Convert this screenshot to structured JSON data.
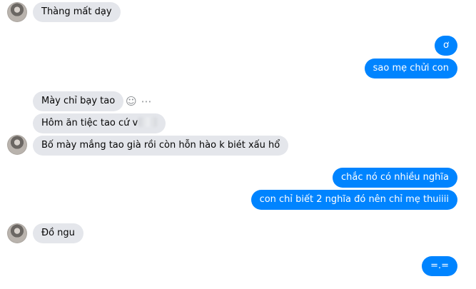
{
  "messages": [
    {
      "id": "m1",
      "side": "in",
      "text": "Thàng mất dạy"
    },
    {
      "id": "m2",
      "side": "out",
      "text": "ơ"
    },
    {
      "id": "m3",
      "side": "out",
      "text": "sao mẹ chửi con"
    },
    {
      "id": "m4",
      "side": "in",
      "text": "Mày chỉ bạy tao"
    },
    {
      "id": "m5",
      "side": "in",
      "text": "Hôm ăn tiệc tao cứ v"
    },
    {
      "id": "m6",
      "side": "in",
      "text": "Bố mày mắng tao già rồi còn hỗn hào k biét xấu hổ"
    },
    {
      "id": "m7",
      "side": "out",
      "text": "chắc nó có nhiều nghĩa"
    },
    {
      "id": "m8",
      "side": "out",
      "text": "con chỉ biết 2 nghĩa đó nên chỉ mẹ thuiiii"
    },
    {
      "id": "m9",
      "side": "in",
      "text": "Đồ ngu"
    },
    {
      "id": "m10",
      "side": "out",
      "text": "=.="
    }
  ],
  "message_actions": {
    "react_icon": "smiley-face-icon",
    "more_icon": "more-options-icon"
  },
  "colors": {
    "incoming_bubble": "#e4e6eb",
    "outgoing_bubble": "#0084ff",
    "background": "#ffffff"
  }
}
